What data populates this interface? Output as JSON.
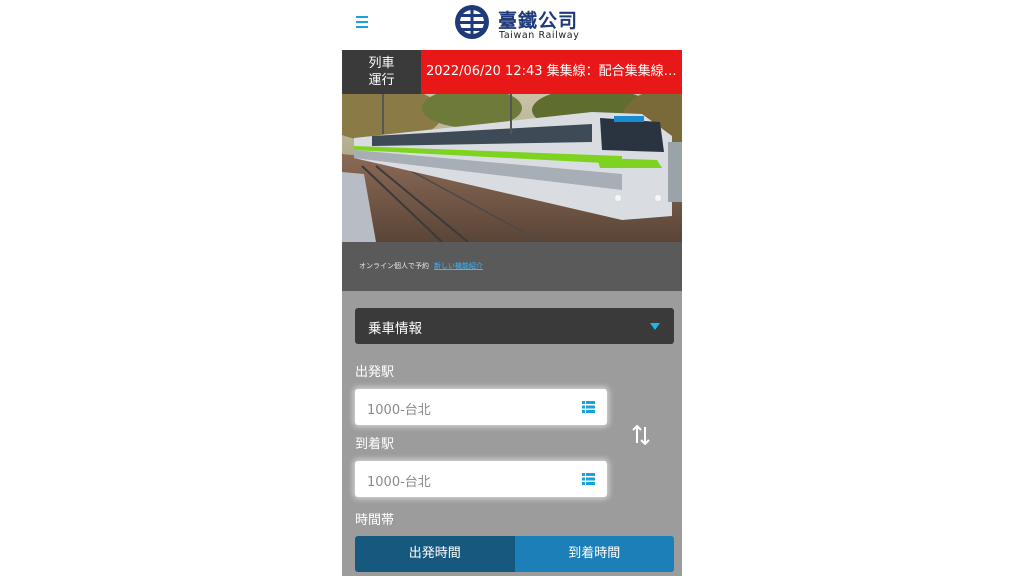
{
  "header": {
    "brand_zh": "臺鐵公司",
    "brand_en": "Taiwan Railway",
    "menu_icon": "hamburger-menu-icon",
    "accent_color": "#1aa3d9"
  },
  "ticker": {
    "label_line1": "列車",
    "label_line2": "運行",
    "message": "2022/06/20 12:43 集集線：配合集集線…",
    "label_color": "#3a3a3a",
    "message_color": "#e81818"
  },
  "banner": {
    "image": "commuter train photo"
  },
  "booking": {
    "text": "オンライン個人で予約",
    "link": "新しい機能紹介"
  },
  "form": {
    "section_select": "乗車情報",
    "departure_label": "出発駅",
    "departure_value": "1000-台北",
    "arrival_label": "到着駅",
    "arrival_value": "1000-台北",
    "time_label": "時間帯",
    "tabs": [
      {
        "label": "出発時間",
        "active": true
      },
      {
        "label": "到着時間",
        "active": false
      }
    ],
    "button_colors": {
      "active": "#17587f",
      "inactive": "#1d7fb8"
    }
  }
}
